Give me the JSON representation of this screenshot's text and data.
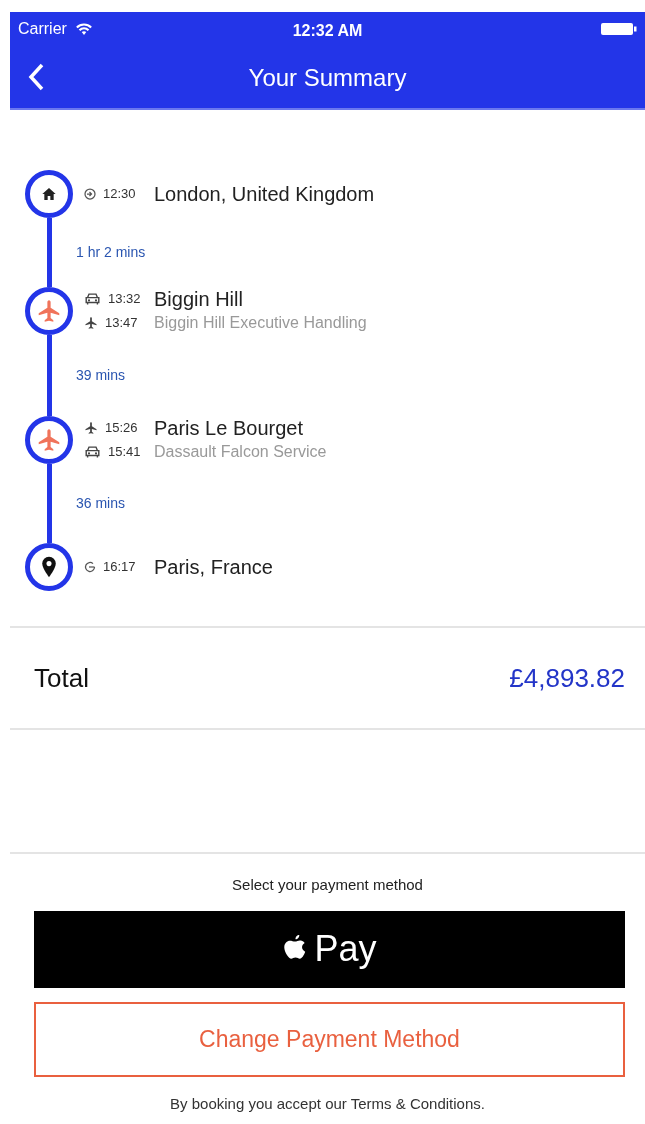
{
  "status_bar": {
    "carrier": "Carrier",
    "time": "12:32 AM"
  },
  "nav": {
    "title": "Your Summary"
  },
  "stops": [
    {
      "kind": "home",
      "times": [
        {
          "kind": "depart",
          "time": "12:30"
        }
      ],
      "name": "London, United Kingdom"
    },
    {
      "kind": "plane",
      "times": [
        {
          "kind": "car",
          "time": "13:32"
        },
        {
          "kind": "plane",
          "time": "13:47"
        }
      ],
      "name": "Biggin Hill",
      "detail": "Biggin Hill Executive Handling"
    },
    {
      "kind": "plane",
      "times": [
        {
          "kind": "plane",
          "time": "15:26"
        },
        {
          "kind": "car",
          "time": "15:41"
        }
      ],
      "name": "Paris Le Bourget",
      "detail": "Dassault Falcon Service"
    },
    {
      "kind": "pin",
      "times": [
        {
          "kind": "arrive",
          "time": "16:17"
        }
      ],
      "name": "Paris, France"
    }
  ],
  "legs": [
    {
      "duration": "1 hr 2 mins"
    },
    {
      "duration": "39 mins"
    },
    {
      "duration": "36 mins"
    }
  ],
  "total": {
    "label": "Total",
    "amount": "£4,893.82"
  },
  "payment": {
    "prompt": "Select your payment method",
    "apple_pay_label": "Pay",
    "change_button": "Change Payment Method",
    "terms_text": "By booking you accept our ",
    "terms_link": "Terms & Conditions",
    "terms_end": "."
  }
}
